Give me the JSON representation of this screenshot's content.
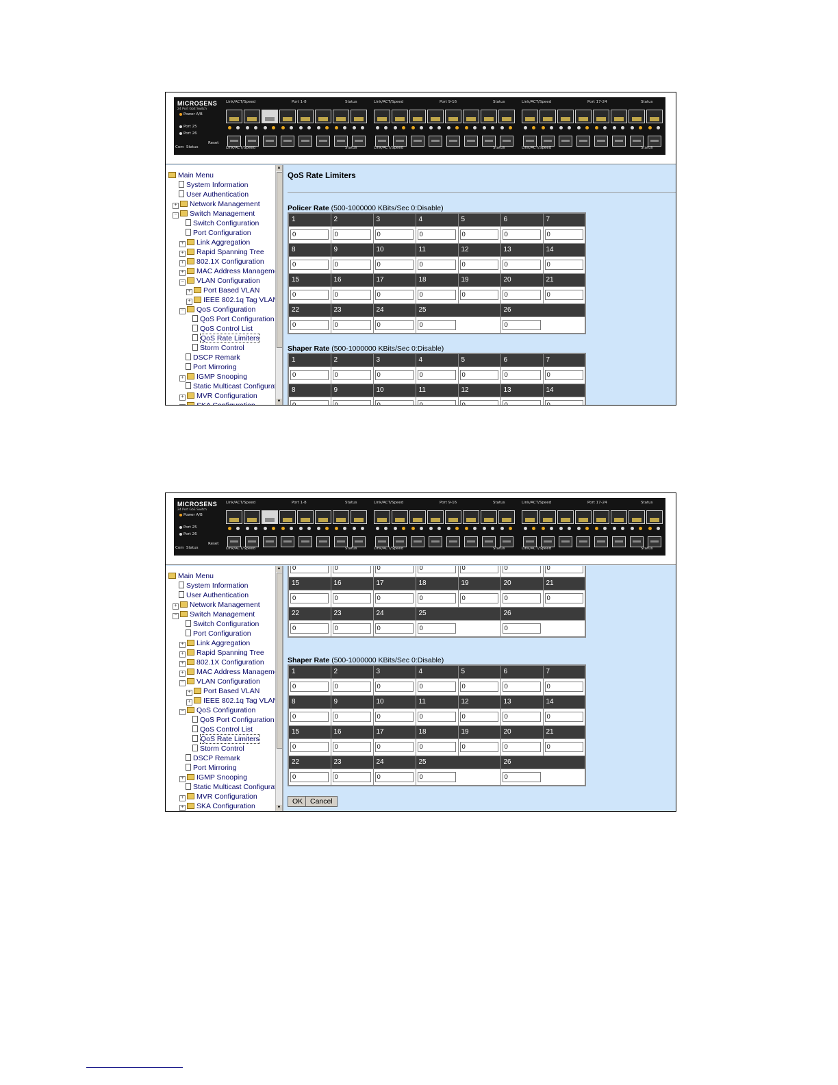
{
  "device": {
    "brand": "MICROSENS",
    "subtitle": "24 Port GbE Switch",
    "power_label": "Power A/B",
    "port25_label": "Port 25",
    "port26_label": "Port 26",
    "com_label": "Com",
    "status_label": "Status",
    "reset_label": "Reset",
    "groups": [
      {
        "top_left": "Link/ACT/Speed",
        "top_mid": "Port 1-8",
        "top_right": "Status",
        "bottom_left": "Link/ACT/Speed",
        "bottom_right": "Status"
      },
      {
        "top_left": "Link/ACT/Speed",
        "top_mid": "Port 9-16",
        "top_right": "Status",
        "bottom_left": "Link/ACT/Speed",
        "bottom_right": "Status"
      },
      {
        "top_left": "Link/ACT/Speed",
        "top_mid": "Port 17-24",
        "top_right": "Status",
        "bottom_left": "Link/ACT/Speed",
        "bottom_right": "Status"
      }
    ]
  },
  "menu": [
    {
      "label": "Main Menu",
      "level": 0,
      "type": "folder"
    },
    {
      "label": "System Information",
      "level": 1,
      "type": "doc"
    },
    {
      "label": "User Authentication",
      "level": 1,
      "type": "doc"
    },
    {
      "label": "Network Management",
      "level": 1,
      "type": "folder"
    },
    {
      "label": "Switch Management",
      "level": 1,
      "type": "folder"
    },
    {
      "label": "Switch Configuration",
      "level": 2,
      "type": "doc"
    },
    {
      "label": "Port Configuration",
      "level": 2,
      "type": "doc"
    },
    {
      "label": "Link Aggregation",
      "level": 2,
      "type": "folder"
    },
    {
      "label": "Rapid Spanning Tree",
      "level": 2,
      "type": "folder"
    },
    {
      "label": "802.1X Configuration",
      "level": 2,
      "type": "folder"
    },
    {
      "label": "MAC Address Managemen",
      "level": 2,
      "type": "folder"
    },
    {
      "label": "VLAN Configuration",
      "level": 2,
      "type": "folder"
    },
    {
      "label": "Port Based VLAN",
      "level": 3,
      "type": "folder"
    },
    {
      "label": "IEEE 802.1q Tag VLAN",
      "level": 3,
      "type": "folder"
    },
    {
      "label": "QoS Configuration",
      "level": 2,
      "type": "folder"
    },
    {
      "label": "QoS Port Configuration",
      "level": 3,
      "type": "doc"
    },
    {
      "label": "QoS Control List",
      "level": 3,
      "type": "doc"
    },
    {
      "label": "QoS Rate Limiters",
      "level": 3,
      "type": "doc",
      "active": true
    },
    {
      "label": "Storm Control",
      "level": 3,
      "type": "doc"
    },
    {
      "label": "DSCP Remark",
      "level": 2,
      "type": "doc"
    },
    {
      "label": "Port Mirroring",
      "level": 2,
      "type": "doc"
    },
    {
      "label": "IGMP Snooping",
      "level": 2,
      "type": "folder"
    },
    {
      "label": "Static Multicast Configuratic",
      "level": 2,
      "type": "doc"
    },
    {
      "label": "MVR Configuration",
      "level": 2,
      "type": "folder"
    },
    {
      "label": "SKA Configuration",
      "level": 2,
      "type": "folder"
    }
  ],
  "page": {
    "title": "QoS Rate Limiters",
    "policer_title": "Policer Rate",
    "policer_note": " (500-1000000 KBits/Sec 0:Disable)",
    "shaper_title": "Shaper Rate",
    "shaper_note": " (500-1000000 KBits/Sec 0:Disable)",
    "ok_label": "OK",
    "cancel_label": "Cancel"
  },
  "ports": {
    "row1": [
      "1",
      "2",
      "3",
      "4",
      "5",
      "6",
      "7"
    ],
    "row2": [
      "8",
      "9",
      "10",
      "11",
      "12",
      "13",
      "14"
    ],
    "row3": [
      "15",
      "16",
      "17",
      "18",
      "19",
      "20",
      "21"
    ],
    "row4": [
      "22",
      "23",
      "24",
      "25",
      "26"
    ]
  },
  "policer_values": [
    "0",
    "0",
    "0",
    "0",
    "0",
    "0",
    "0",
    "0",
    "0",
    "0",
    "0",
    "0",
    "0",
    "0",
    "0",
    "0",
    "0",
    "0",
    "0",
    "0",
    "0",
    "0",
    "0",
    "0",
    "0",
    "0"
  ],
  "shaper_values": [
    "0",
    "0",
    "0",
    "0",
    "0",
    "0",
    "0",
    "0",
    "0",
    "0",
    "0",
    "0",
    "0",
    "0",
    "0",
    "0",
    "0",
    "0",
    "0",
    "0",
    "0",
    "0",
    "0",
    "0",
    "0",
    "0"
  ]
}
